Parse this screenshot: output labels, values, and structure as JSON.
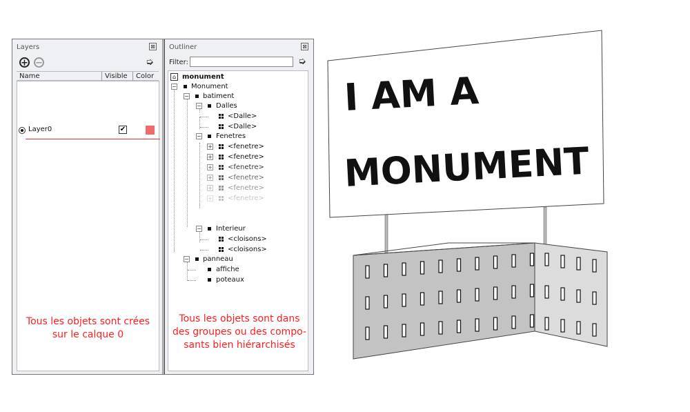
{
  "layers_panel": {
    "title": "Layers",
    "close": "⊠",
    "columns": {
      "name": "Name",
      "visible": "Visible",
      "color": "Color"
    },
    "layer": {
      "name": "Layer0",
      "visible": "✔",
      "color": "#f06a6e"
    },
    "note_line1": "Tous les objets sont crées",
    "note_line2": "sur le calque 0"
  },
  "outliner_panel": {
    "title": "Outliner",
    "close": "⊠",
    "filter_label": "Filter:",
    "filter_value": "",
    "root": "monument",
    "tree": {
      "monument": "Monument",
      "batiment": "batiment",
      "dalles": "Dalles",
      "dalle1": "<Dalle>",
      "dalle2": "<Dalle>",
      "fenetres": "Fenetres",
      "fenetre": "<fenetre>",
      "interieur": "Interieur",
      "cloisons1": "<cloisons>",
      "cloisons2": "<cloisons>",
      "panneau": "panneau",
      "affiche": "affiche",
      "poteaux": "poteaux"
    },
    "note_line1": "Tous les objets sont dans",
    "note_line2": "des groupes ou des compo-",
    "note_line3": "sants bien hiérarchisés"
  },
  "scene": {
    "sign_line1": "I AM A",
    "sign_line2": "MONUMENT"
  }
}
